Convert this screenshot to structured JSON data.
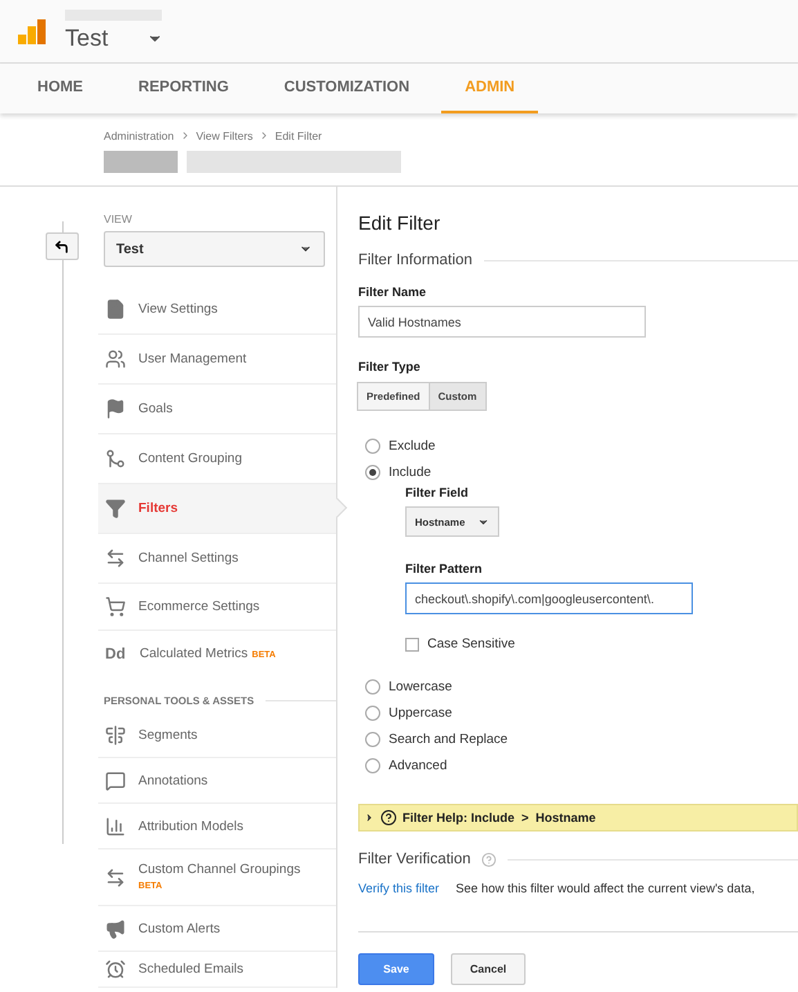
{
  "header": {
    "property": "Test"
  },
  "nav_tabs": [
    {
      "label": "HOME",
      "selected": false
    },
    {
      "label": "REPORTING",
      "selected": false
    },
    {
      "label": "CUSTOMIZATION",
      "selected": false
    },
    {
      "label": "ADMIN",
      "selected": true
    }
  ],
  "breadcrumb": [
    "Administration",
    "View Filters",
    "Edit Filter"
  ],
  "sidebar": {
    "view_label": "VIEW",
    "view_select": "Test",
    "items": [
      {
        "label": "View Settings",
        "selected": false
      },
      {
        "label": "User Management",
        "selected": false
      },
      {
        "label": "Goals",
        "selected": false
      },
      {
        "label": "Content Grouping",
        "selected": false
      },
      {
        "label": "Filters",
        "selected": true
      },
      {
        "label": "Channel Settings",
        "selected": false
      },
      {
        "label": "Ecommerce Settings",
        "selected": false
      },
      {
        "label": "Calculated Metrics",
        "icon_text": "Dd",
        "badge": "BETA",
        "selected": false
      }
    ],
    "section_title": "PERSONAL TOOLS & ASSETS",
    "personal_items": [
      {
        "label": "Segments",
        "selected": false
      },
      {
        "label": "Annotations",
        "selected": false
      },
      {
        "label": "Attribution Models",
        "selected": false
      },
      {
        "label": "Custom Channel Groupings",
        "badge": "BETA",
        "badge_below": true,
        "selected": false
      },
      {
        "label": "Custom Alerts",
        "selected": false
      },
      {
        "label": "Scheduled Emails",
        "selected": false
      }
    ]
  },
  "form": {
    "title": "Edit Filter",
    "section": "Filter Information",
    "name_label": "Filter Name",
    "name_value": "Valid Hostnames",
    "type_label": "Filter Type",
    "type_options": [
      {
        "label": "Predefined",
        "selected": false
      },
      {
        "label": "Custom",
        "selected": true
      }
    ],
    "mode_options": [
      {
        "label": "Exclude",
        "selected": false
      },
      {
        "label": "Include",
        "selected": true
      }
    ],
    "field_label": "Filter Field",
    "field_value": "Hostname",
    "pattern_label": "Filter Pattern",
    "pattern_value": "checkout\\.shopify\\.com|googleusercontent\\.",
    "case_sensitive": {
      "label": "Case Sensitive",
      "checked": false
    },
    "other_options": [
      {
        "label": "Lowercase",
        "selected": false
      },
      {
        "label": "Uppercase",
        "selected": false
      },
      {
        "label": "Search and Replace",
        "selected": false
      },
      {
        "label": "Advanced",
        "selected": false
      }
    ],
    "help": "Filter Help: Include  >  Hostname",
    "verification_title": "Filter Verification",
    "verify_link": "Verify this filter",
    "verify_text": "See how this filter would affect the current view's data,",
    "buttons": [
      "Save",
      "Cancel"
    ]
  }
}
